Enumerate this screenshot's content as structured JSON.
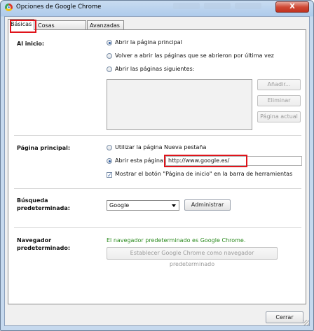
{
  "window": {
    "title": "Opciones de Google Chrome",
    "close_glyph": "X"
  },
  "tabs": [
    {
      "label": "Básicas",
      "active": true
    },
    {
      "label": "Cosas personales",
      "active": false
    },
    {
      "label": "Avanzadas",
      "active": false
    }
  ],
  "inicio": {
    "label": "Al inicio:",
    "options": [
      {
        "label": "Abrir la página principal",
        "selected": true
      },
      {
        "label": "Volver a abrir las páginas que se abrieron por última vez",
        "selected": false
      },
      {
        "label": "Abrir las páginas siguientes:",
        "selected": false
      }
    ],
    "buttons": {
      "add": "Añadir...",
      "remove": "Eliminar",
      "current": "Página actual"
    }
  },
  "home": {
    "label": "Página principal:",
    "option_new_tab": "Utilizar la página Nueva pestaña",
    "option_open_page": "Abrir esta página:",
    "url": "http://www.google.es/",
    "show_home_button": "Mostrar el botón \"Página de inicio\" en la barra de herramientas",
    "show_home_button_checked": true
  },
  "search": {
    "label_line1": "Búsqueda",
    "label_line2": "predeterminada:",
    "engine": "Google",
    "manage": "Administrar"
  },
  "browser": {
    "label_line1": "Navegador",
    "label_line2": "predeterminado:",
    "status": "El navegador predeterminado es Google Chrome.",
    "make_default": "Establecer Google Chrome como navegador predeterminado"
  },
  "footer": {
    "close": "Cerrar"
  },
  "colors": {
    "highlight": "#e0141b",
    "status_green": "#2a8a1d",
    "accent": "#2c5aa0"
  }
}
